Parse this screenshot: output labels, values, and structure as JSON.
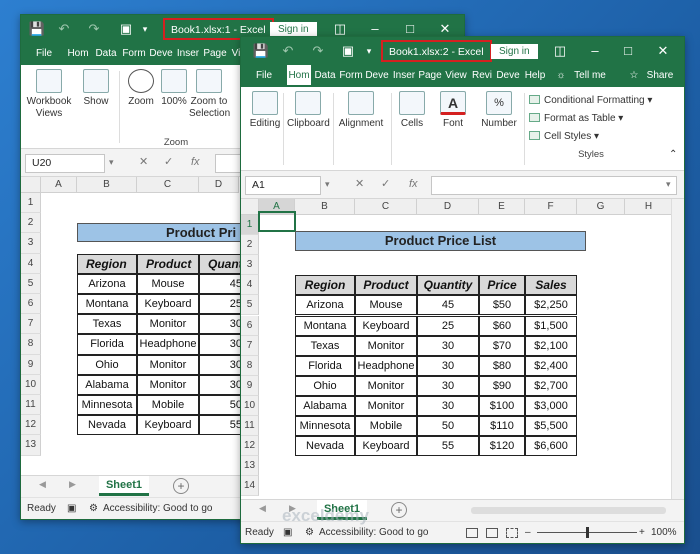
{
  "windows": [
    {
      "title": "Book1.xlsx:1  -  Excel",
      "sign_in": "Sign in",
      "tabs": [
        "File",
        "Hom",
        "Data",
        "Form",
        "Deve",
        "Inser",
        "Page",
        "Vi"
      ],
      "ribbon": {
        "workbook_views": "Workbook Views",
        "show": "Show",
        "zoom": "Zoom",
        "zoom100": "100%",
        "zoom_to_selection": "Zoom to Selection",
        "zoom_group": "Zoom"
      },
      "name_box": "U20",
      "fx": "fx",
      "columns": [
        "A",
        "B",
        "C",
        "D"
      ],
      "rows": [
        "1",
        "2",
        "3",
        "4",
        "5",
        "6",
        "7",
        "8",
        "9",
        "10",
        "11",
        "12",
        "13"
      ],
      "table_title": "Product Pri",
      "headers": [
        "Region",
        "Product",
        "Quant"
      ],
      "data": [
        [
          "Arizona",
          "Mouse",
          "45"
        ],
        [
          "Montana",
          "Keyboard",
          "25"
        ],
        [
          "Texas",
          "Monitor",
          "30"
        ],
        [
          "Florida",
          "Headphone",
          "30"
        ],
        [
          "Ohio",
          "Monitor",
          "30"
        ],
        [
          "Alabama",
          "Monitor",
          "30"
        ],
        [
          "Minnesota",
          "Mobile",
          "50"
        ],
        [
          "Nevada",
          "Keyboard",
          "55"
        ]
      ],
      "sheet_tab": "Sheet1",
      "status_ready": "Ready",
      "status_accessibility": "Accessibility: Good to go"
    },
    {
      "title": "Book1.xlsx:2  -  Excel",
      "sign_in": "Sign in",
      "tabs": [
        "File",
        "Hom",
        "Data",
        "Form",
        "Deve",
        "Inser",
        "Page",
        "View",
        "Revi",
        "Deve",
        "Help"
      ],
      "tell_me": "Tell me",
      "share": "Share",
      "ribbon": {
        "editing": "Editing",
        "clipboard": "Clipboard",
        "alignment": "Alignment",
        "cells": "Cells",
        "font": "Font",
        "number": "Number",
        "conditional_formatting": "Conditional Formatting",
        "format_as_table": "Format as Table",
        "cell_styles": "Cell Styles",
        "styles_group": "Styles"
      },
      "name_box": "A1",
      "fx": "fx",
      "columns": [
        "A",
        "B",
        "C",
        "D",
        "E",
        "F",
        "G",
        "H"
      ],
      "rows": [
        "1",
        "2",
        "3",
        "4",
        "5",
        "6",
        "7",
        "8",
        "9",
        "10",
        "11",
        "12",
        "13",
        "14"
      ],
      "table_title": "Product Price List",
      "headers": [
        "Region",
        "Product",
        "Quantity",
        "Price",
        "Sales"
      ],
      "data": [
        [
          "Arizona",
          "Mouse",
          "45",
          "$50",
          "$2,250"
        ],
        [
          "Montana",
          "Keyboard",
          "25",
          "$60",
          "$1,500"
        ],
        [
          "Texas",
          "Monitor",
          "30",
          "$70",
          "$2,100"
        ],
        [
          "Florida",
          "Headphone",
          "30",
          "$80",
          "$2,400"
        ],
        [
          "Ohio",
          "Monitor",
          "30",
          "$90",
          "$2,700"
        ],
        [
          "Alabama",
          "Monitor",
          "30",
          "$100",
          "$3,000"
        ],
        [
          "Minnesota",
          "Mobile",
          "50",
          "$110",
          "$5,500"
        ],
        [
          "Nevada",
          "Keyboard",
          "55",
          "$120",
          "$6,600"
        ]
      ],
      "sheet_tab": "Sheet1",
      "status_ready": "Ready",
      "status_accessibility": "Accessibility: Good to go",
      "zoom_level": "100%"
    }
  ],
  "watermark": "exceldemy",
  "colors": {
    "excel_green": "#217346",
    "header_fill": "#d9d9d9",
    "title_fill": "#9dc3e6",
    "highlight_border": "#d42020"
  }
}
